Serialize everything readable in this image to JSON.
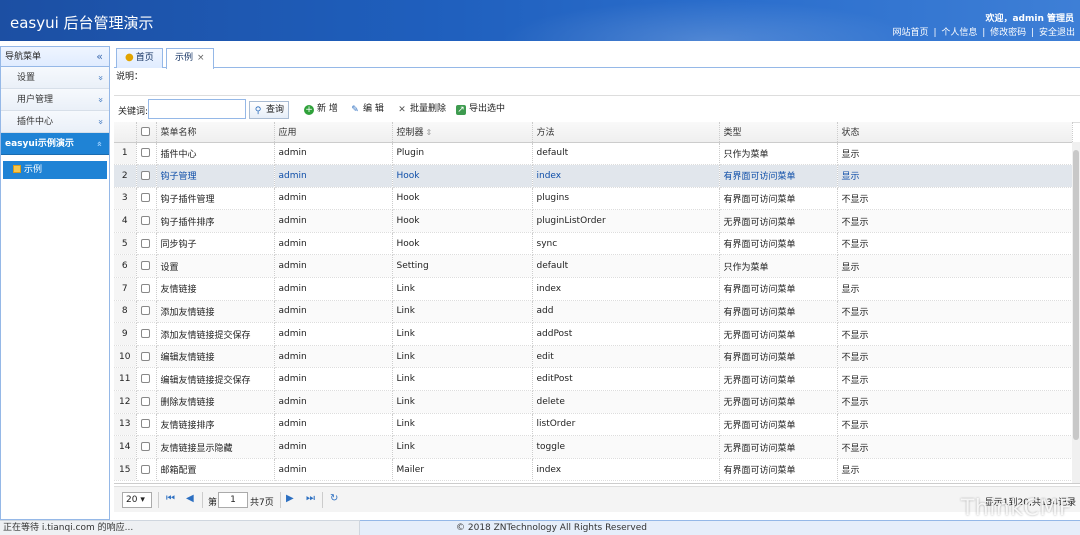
{
  "header": {
    "title": "easyui 后台管理演示",
    "welcome": "欢迎，admin 管理员",
    "links": [
      "网站首页",
      "个人信息",
      "修改密码",
      "安全退出"
    ],
    "link_sep": "|"
  },
  "sidebar": {
    "title": "导航菜单",
    "collapse_icon": "«",
    "items": [
      {
        "label": "设置"
      },
      {
        "label": "用户管理"
      },
      {
        "label": "插件中心"
      },
      {
        "label": "easyui示例演示"
      }
    ],
    "chevron": "»",
    "sub_item": "示例"
  },
  "tabs": [
    {
      "label": "首页"
    },
    {
      "label": "示例",
      "close": "×"
    }
  ],
  "desc_label": "说明：",
  "toolbar": {
    "keyword_label": "关键词:",
    "keyword_value": "",
    "search": "查询",
    "add": "新 增",
    "edit": "编 辑",
    "batch_delete": "批量删除",
    "export": "导出选中"
  },
  "grid": {
    "columns": [
      "菜单名称",
      "应用",
      "控制器",
      "方法",
      "类型",
      "状态"
    ],
    "rows": [
      [
        "1",
        "插件中心",
        "admin",
        "Plugin",
        "default",
        "只作为菜单",
        "显示"
      ],
      [
        "2",
        "钩子管理",
        "admin",
        "Hook",
        "index",
        "有界面可访问菜单",
        "显示"
      ],
      [
        "3",
        "钩子插件管理",
        "admin",
        "Hook",
        "plugins",
        "有界面可访问菜单",
        "不显示"
      ],
      [
        "4",
        "钩子插件排序",
        "admin",
        "Hook",
        "pluginListOrder",
        "无界面可访问菜单",
        "不显示"
      ],
      [
        "5",
        "同步钩子",
        "admin",
        "Hook",
        "sync",
        "有界面可访问菜单",
        "不显示"
      ],
      [
        "6",
        "设置",
        "admin",
        "Setting",
        "default",
        "只作为菜单",
        "显示"
      ],
      [
        "7",
        "友情链接",
        "admin",
        "Link",
        "index",
        "有界面可访问菜单",
        "显示"
      ],
      [
        "8",
        "添加友情链接",
        "admin",
        "Link",
        "add",
        "有界面可访问菜单",
        "不显示"
      ],
      [
        "9",
        "添加友情链接提交保存",
        "admin",
        "Link",
        "addPost",
        "无界面可访问菜单",
        "不显示"
      ],
      [
        "10",
        "编辑友情链接",
        "admin",
        "Link",
        "edit",
        "有界面可访问菜单",
        "不显示"
      ],
      [
        "11",
        "编辑友情链接提交保存",
        "admin",
        "Link",
        "editPost",
        "无界面可访问菜单",
        "不显示"
      ],
      [
        "12",
        "删除友情链接",
        "admin",
        "Link",
        "delete",
        "无界面可访问菜单",
        "不显示"
      ],
      [
        "13",
        "友情链接排序",
        "admin",
        "Link",
        "listOrder",
        "无界面可访问菜单",
        "不显示"
      ],
      [
        "14",
        "友情链接显示隐藏",
        "admin",
        "Link",
        "toggle",
        "无界面可访问菜单",
        "不显示"
      ],
      [
        "15",
        "邮箱配置",
        "admin",
        "Mailer",
        "index",
        "有界面可访问菜单",
        "显示"
      ]
    ],
    "selected_row": 2
  },
  "pager": {
    "page_size": "20",
    "page_label": "第",
    "page_value": "1",
    "total_label": "共7页",
    "info": "显示1到20,共134记录"
  },
  "status_text": "正在等待 i.tianqi.com 的响应...",
  "footer": "© 2018 ZNTechnology All Rights Reserved",
  "watermark": "ThinkCMF",
  "colors": {
    "header": "#1f5fbd",
    "accent": "#1f83d5",
    "selected_row": "#e1e6ec"
  }
}
